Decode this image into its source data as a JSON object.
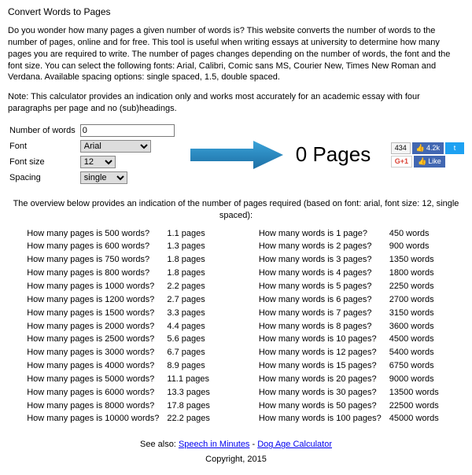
{
  "title": "Convert Words to Pages",
  "intro": "Do you wonder how many pages a given number of words is? This website converts the number of words to the number of pages, online and for free. This tool is useful when writing essays at university to determine how many pages you are required to write. The number of pages changes depending on the number of words, the font and the font size. You can select the following fonts: Arial, Calibri, Comic sans MS, Courier New, Times New Roman and Verdana. Available spacing options: single spaced, 1.5, double spaced.",
  "note": "Note: This calculator provides an indication only and works most accurately for an academic essay with four paragraphs per page and no (sub)headings.",
  "form": {
    "words_label": "Number of words",
    "words_value": "0",
    "font_label": "Font",
    "font_value": "Arial",
    "size_label": "Font size",
    "size_value": "12",
    "spacing_label": "Spacing",
    "spacing_value": "single"
  },
  "result": {
    "number": "0",
    "unit": "Pages"
  },
  "social": {
    "count1": "434",
    "like_count": "4.2k",
    "gplus": "G+1",
    "like_label": "Like"
  },
  "overview_intro": "The overview below provides an indication of the number of pages required (based on font: arial, font size: 12, single spaced):",
  "words_to_pages": [
    {
      "q": "How many pages is 500 words?",
      "a": "1.1 pages"
    },
    {
      "q": "How many pages is 600 words?",
      "a": "1.3 pages"
    },
    {
      "q": "How many pages is 750 words?",
      "a": "1.8 pages"
    },
    {
      "q": "How many pages is 800 words?",
      "a": "1.8 pages"
    },
    {
      "q": "How many pages is 1000 words?",
      "a": "2.2 pages"
    },
    {
      "q": "How many pages is 1200 words?",
      "a": "2.7 pages"
    },
    {
      "q": "How many pages is 1500 words?",
      "a": "3.3 pages"
    },
    {
      "q": "How many pages is 2000 words?",
      "a": "4.4 pages"
    },
    {
      "q": "How many pages is 2500 words?",
      "a": "5.6 pages"
    },
    {
      "q": "How many pages is 3000 words?",
      "a": "6.7 pages"
    },
    {
      "q": "How many pages is 4000 words?",
      "a": "8.9 pages"
    },
    {
      "q": "How many pages is 5000 words?",
      "a": "11.1 pages"
    },
    {
      "q": "How many pages is 6000 words?",
      "a": "13.3 pages"
    },
    {
      "q": "How many pages is 8000 words?",
      "a": "17.8 pages"
    },
    {
      "q": "How many pages is 10000 words?",
      "a": "22.2 pages"
    }
  ],
  "pages_to_words": [
    {
      "q": "How many words is 1 page?",
      "a": "450 words"
    },
    {
      "q": "How many words is 2 pages?",
      "a": "900 words"
    },
    {
      "q": "How many words is 3 pages?",
      "a": "1350 words"
    },
    {
      "q": "How many words is 4 pages?",
      "a": "1800 words"
    },
    {
      "q": "How many words is 5 pages?",
      "a": "2250 words"
    },
    {
      "q": "How many words is 6 pages?",
      "a": "2700 words"
    },
    {
      "q": "How many words is 7 pages?",
      "a": "3150 words"
    },
    {
      "q": "How many words is 8 pages?",
      "a": "3600 words"
    },
    {
      "q": "How many words is 10 pages?",
      "a": "4500 words"
    },
    {
      "q": "How many words is 12 pages?",
      "a": "5400 words"
    },
    {
      "q": "How many words is 15 pages?",
      "a": "6750 words"
    },
    {
      "q": "How many words is 20 pages?",
      "a": "9000 words"
    },
    {
      "q": "How many words is 30 pages?",
      "a": "13500 words"
    },
    {
      "q": "How many words is 50 pages?",
      "a": "22500 words"
    },
    {
      "q": "How many words is 100 pages?",
      "a": "45000 words"
    }
  ],
  "footer": {
    "see_also": "See also:",
    "link1": "Speech in Minutes",
    "sep": " - ",
    "link2": "Dog Age Calculator",
    "copyright": "Copyright, 2015"
  }
}
